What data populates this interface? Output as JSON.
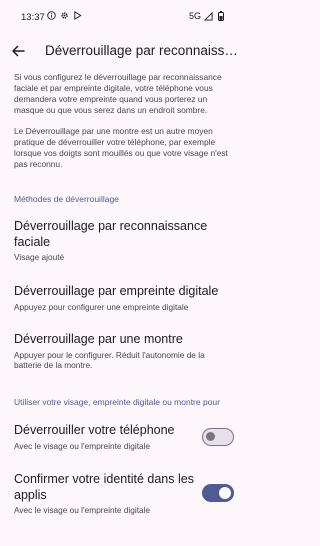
{
  "status_bar": {
    "time": "13:37",
    "network": "5G",
    "left_icons": [
      "info-icon",
      "gear-icon",
      "play-store-icon"
    ],
    "right_icons": [
      "signal-icon",
      "battery-icon"
    ]
  },
  "appbar": {
    "title": "Déverrouillage par reconnaissance faciale et par empreinte digitale"
  },
  "intro": {
    "paragraph1": "Si vous configurez le déverrouillage par reconnaissance faciale et par empreinte digitale, votre téléphone vous demandera votre empreinte quand vous porterez un masque ou que vous serez dans un endroit sombre.",
    "paragraph2": "Le Déverrouillage par une montre est un autre moyen pratique de déverrouiller votre téléphone, par exemple lorsque vos doigts sont mouillés ou que votre visage n'est pas reconnu."
  },
  "methods": {
    "section_title": "Méthodes de déverrouillage",
    "items": [
      {
        "title": "Déverrouillage par reconnaissance faciale",
        "subtitle": "Visage ajouté"
      },
      {
        "title": "Déverrouillage par empreinte digitale",
        "subtitle": "Appuyez pour configurer une empreinte digitale"
      },
      {
        "title": "Déverrouillage par une montre",
        "subtitle": "Appuyer pour le configurer. Réduit l'autonomie de la batterie de la montre."
      }
    ]
  },
  "usage": {
    "section_title": "Utiliser votre visage, empreinte digitale ou montre pour",
    "items": [
      {
        "title": "Déverrouiller votre téléphone",
        "subtitle": "Avec le visage ou l'empreinte digitale",
        "enabled": false
      },
      {
        "title": "Confirmer votre identité dans les applis",
        "subtitle": "Avec le visage ou l'empreinte digitale",
        "enabled": true
      }
    ]
  },
  "colors": {
    "background": "#fdf7fb",
    "accent": "#4f5b92",
    "text_primary": "#1c1b1f",
    "text_secondary": "#49454f"
  }
}
